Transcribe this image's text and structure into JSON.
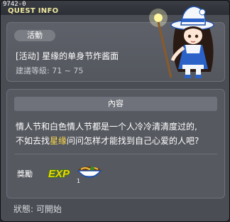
{
  "window": {
    "quest_id": "9742-0",
    "title": "QUEST INFO"
  },
  "quest": {
    "category": "活動",
    "name": "[活动] 星缘的单身节炸酱面",
    "level_requirement": "建議等級: 71 ~ 75"
  },
  "content": {
    "header": "內容",
    "line1": "情人节和白色情人节都是一个人冷冷清清度过的,",
    "line2_before": "不如去找",
    "line2_highlight": "星缘",
    "line2_after": "问问怎样才能找到自己心爱的人吧?"
  },
  "rewards": {
    "label": "獎勵",
    "items": [
      {
        "icon": "exp-icon",
        "text": "EXP"
      },
      {
        "icon": "noodle-bowl-icon",
        "count": "1"
      }
    ]
  },
  "status": {
    "text": "狀態:  可開始"
  },
  "colors": {
    "title": "#f0e9a0",
    "highlight": "#ffd84a",
    "exp_text": "#f2d400"
  }
}
